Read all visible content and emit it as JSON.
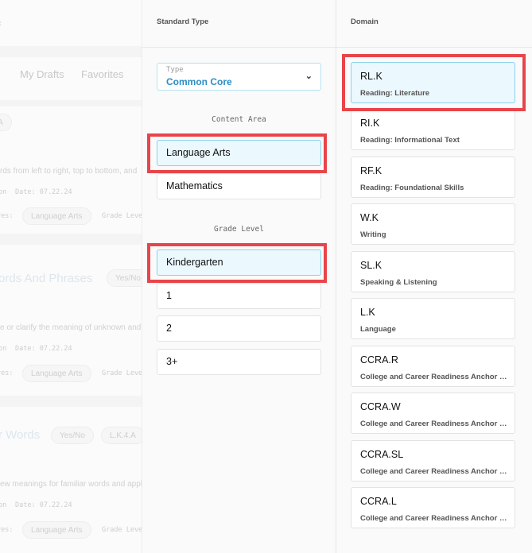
{
  "background": {
    "tabs": [
      "My Drafts",
      "Favorites"
    ],
    "card1": {
      "chip_top": "A",
      "text": "rds from left to right, top to bottom, and",
      "meta_on": "on",
      "meta_date": "Date: 07.22.24",
      "res_label": "res:",
      "res_chip": "Language Arts",
      "grade_label": "Grade Leve"
    },
    "card2": {
      "title": "ords And Phrases",
      "chip": "Yes/No",
      "text": "e or clarify the meaning of unknown and",
      "meta_on": "on",
      "meta_date": "Date: 07.22.24",
      "res_label": "res:",
      "res_chip": "Language Arts",
      "grade_label": "Grade Leve"
    },
    "card3": {
      "title": "r Words",
      "chip1": "Yes/No",
      "chip2": "L.K.4.A",
      "text": "ew meanings for familiar words and appl",
      "meta_on": "on",
      "meta_date": "Date: 07.22.24",
      "res_label": "res:",
      "res_chip": "Language Arts",
      "grade_label": "Grade Leve"
    }
  },
  "standard_type": {
    "header": "Standard Type",
    "type_select": {
      "label": "Type",
      "value": "Common Core"
    },
    "content_area": {
      "title": "Content Area",
      "options": [
        "Language Arts",
        "Mathematics"
      ],
      "selected": "Language Arts"
    },
    "grade_level": {
      "title": "Grade Level",
      "options": [
        "Kindergarten",
        "1",
        "2",
        "3+"
      ],
      "selected": "Kindergarten"
    }
  },
  "domain": {
    "header": "Domain",
    "selected": "RL.K",
    "items": [
      {
        "code": "RL.K",
        "name": "Reading: Literature"
      },
      {
        "code": "RI.K",
        "name": "Reading: Informational Text"
      },
      {
        "code": "RF.K",
        "name": "Reading: Foundational Skills"
      },
      {
        "code": "W.K",
        "name": "Writing"
      },
      {
        "code": "SL.K",
        "name": "Speaking & Listening"
      },
      {
        "code": "L.K",
        "name": "Language"
      },
      {
        "code": "CCRA.R",
        "name": "College and Career Readiness Anchor S..."
      },
      {
        "code": "CCRA.W",
        "name": "College and Career Readiness Anchor S..."
      },
      {
        "code": "CCRA.SL",
        "name": "College and Career Readiness Anchor S..."
      },
      {
        "code": "CCRA.L",
        "name": "College and Career Readiness Anchor S..."
      }
    ]
  },
  "colors": {
    "accent": "#2b8dc4",
    "selected_bg": "#ebf8fe",
    "selected_border": "#8cd2ea",
    "highlight": "#e8454a"
  },
  "icons": {
    "select_chevron": "chevron-down-icon",
    "back": "chevron-left-icon"
  }
}
